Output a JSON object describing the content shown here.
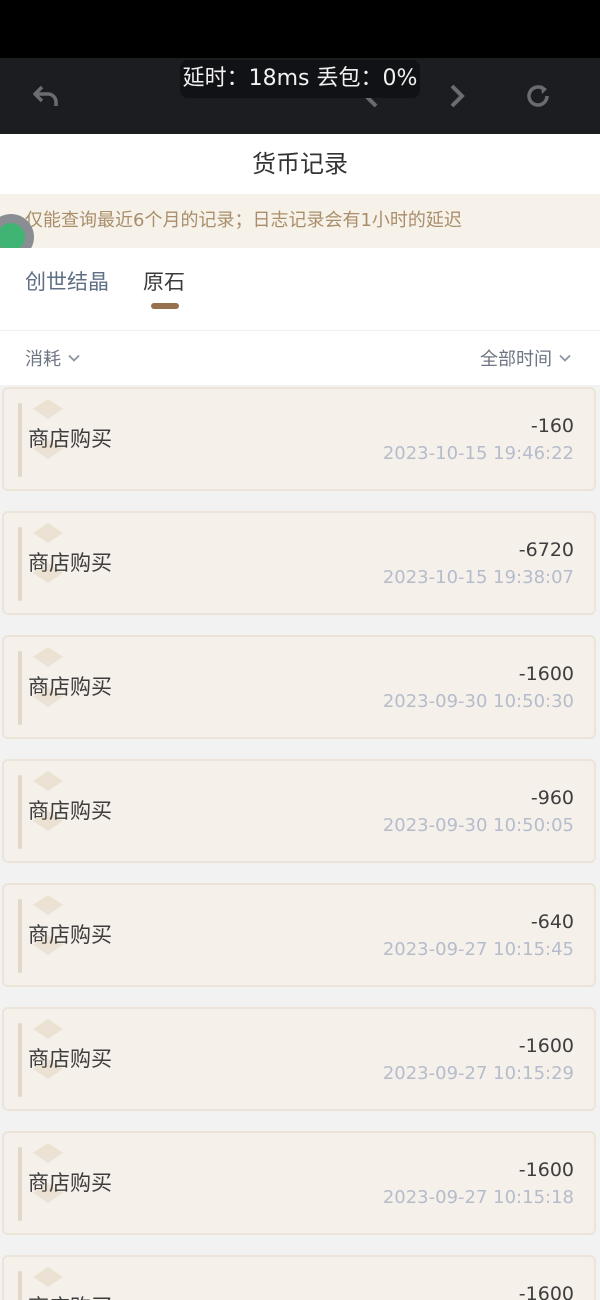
{
  "overlay": {
    "text": "延时：18ms 丢包：0%"
  },
  "header": {
    "title": "货币记录"
  },
  "notice": {
    "text": "仅能查询最近6个月的记录；日志记录会有1小时的延迟"
  },
  "tabs": [
    {
      "label": "创世结晶",
      "active": false
    },
    {
      "label": "原石",
      "active": true
    }
  ],
  "filters": {
    "type_label": "消耗",
    "time_label": "全部时间"
  },
  "records": [
    {
      "title": "商店购买",
      "amount": "-160",
      "time": "2023-10-15 19:46:22"
    },
    {
      "title": "商店购买",
      "amount": "-6720",
      "time": "2023-10-15 19:38:07"
    },
    {
      "title": "商店购买",
      "amount": "-1600",
      "time": "2023-09-30 10:50:30"
    },
    {
      "title": "商店购买",
      "amount": "-960",
      "time": "2023-09-30 10:50:05"
    },
    {
      "title": "商店购买",
      "amount": "-640",
      "time": "2023-09-27 10:15:45"
    },
    {
      "title": "商店购买",
      "amount": "-1600",
      "time": "2023-09-27 10:15:29"
    },
    {
      "title": "商店购买",
      "amount": "-1600",
      "time": "2023-09-27 10:15:18"
    },
    {
      "title": "商店购买",
      "amount": "-1600",
      "time": ""
    }
  ],
  "icons": {
    "back": "undo-arrow-icon",
    "prev": "chevron-left-icon",
    "next": "chevron-right-icon",
    "refresh": "refresh-icon",
    "dropdown": "chevron-down-icon"
  },
  "colors": {
    "accent": "#98724f",
    "notice_bg": "#f7f2e9",
    "notice_text": "#a98e6b",
    "card_bg": "#f5f0ea",
    "time_text": "#b5bccb",
    "float_ball": "#3fb473"
  }
}
